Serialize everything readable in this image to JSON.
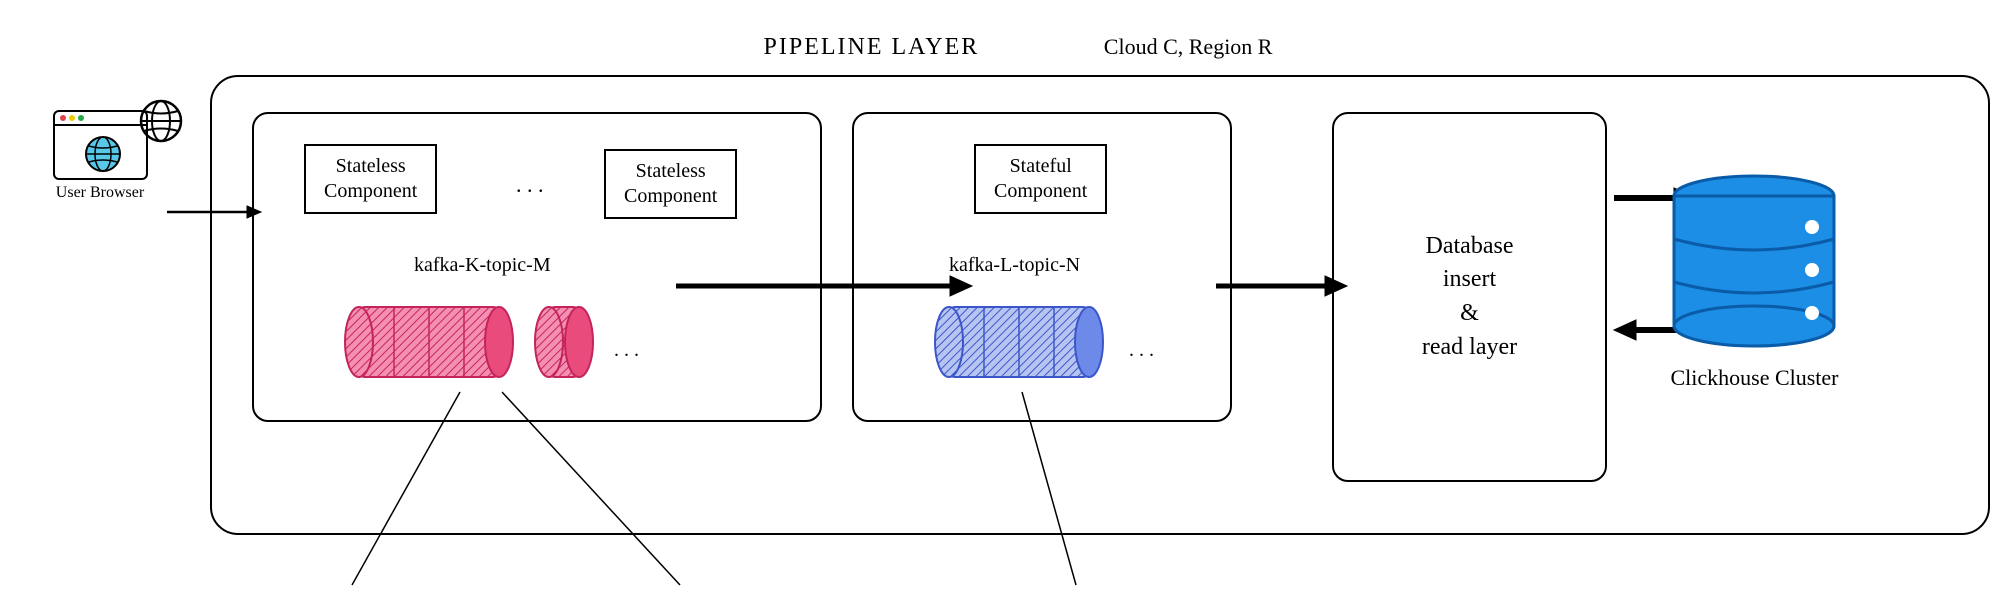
{
  "header": {
    "pipeline_title": "PIPELINE LAYER",
    "cloud_title": "Cloud C, Region R"
  },
  "browser": {
    "label": "User Browser"
  },
  "stateless_group": {
    "comp1": "Stateless\nComponent",
    "ellipsis": ". . .",
    "comp2": "Stateless\nComponent",
    "kafka_label": "kafka-K-topic-M",
    "cyl_ellipsis": ". . ."
  },
  "stateful_group": {
    "comp": "Stateful\nComponent",
    "kafka_label": "kafka-L-topic-N",
    "cyl_ellipsis": ". . ."
  },
  "db_layer": {
    "text": "Database\ninsert\n&\nread layer"
  },
  "clickhouse": {
    "label": "Clickhouse Cluster"
  },
  "colors": {
    "pink_fill": "#e94b7d",
    "pink_stroke": "#c4245b",
    "blue_fill": "#6d8ae8",
    "blue_stroke": "#3b56c9",
    "db_fill": "#1c8ee6",
    "db_stroke": "#0a5ba8"
  }
}
